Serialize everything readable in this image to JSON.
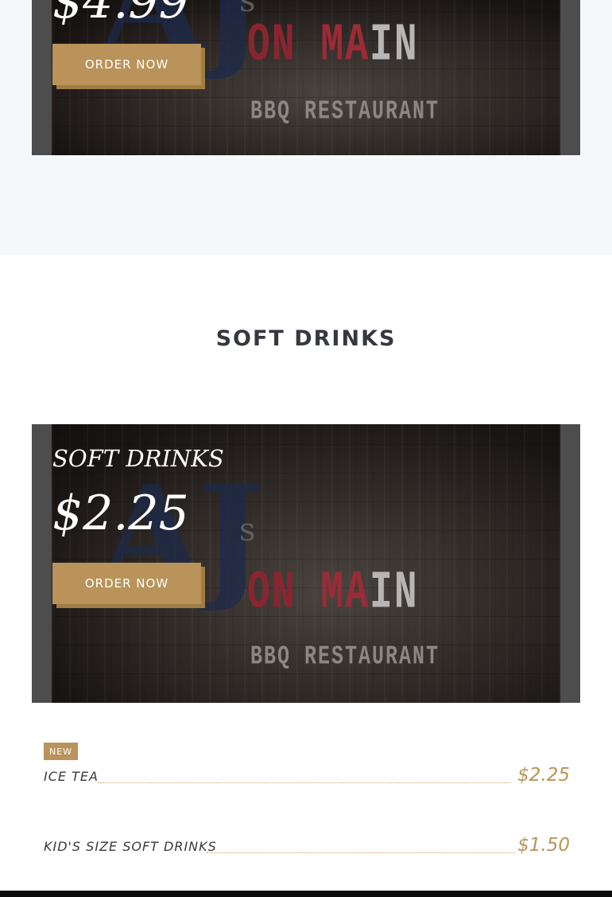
{
  "top_banner": {
    "price": "$4.99",
    "button_label": "ORDER NOW"
  },
  "section": {
    "title": "SOFT DRINKS"
  },
  "drinks_banner": {
    "title": "SOFT DRINKS",
    "price": "$2.25",
    "button_label": "ORDER NOW"
  },
  "banner_logo": {
    "initials": "AJ",
    "possessive": "s",
    "word_on": "ON",
    "word_main_red": "MA",
    "word_main_white": "IN",
    "subtitle": "BBQ RESTAURANT"
  },
  "menu_items": [
    {
      "badge": "NEW",
      "name": "ICE TEA",
      "price": "$2.25"
    },
    {
      "name": "KID'S SIZE SOFT DRINKS",
      "price": "$1.50"
    }
  ],
  "colors": {
    "accent": "#b9935a",
    "heading": "#36383f",
    "top_band_bg": "#f5f8fb"
  }
}
